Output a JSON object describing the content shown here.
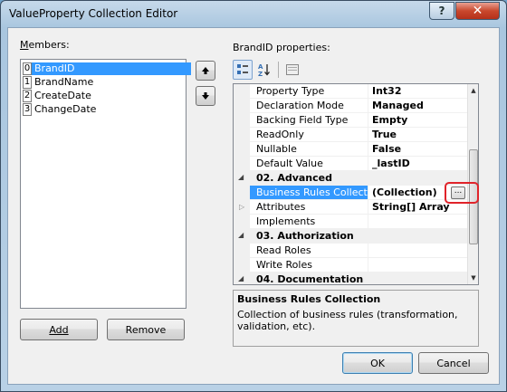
{
  "window": {
    "title": "ValueProperty Collection Editor",
    "help_glyph": "?",
    "close_glyph": "✕"
  },
  "members": {
    "label": "Members:",
    "items": [
      {
        "index": "0",
        "name": "BrandID",
        "selected": true
      },
      {
        "index": "1",
        "name": "BrandName",
        "selected": false
      },
      {
        "index": "2",
        "name": "CreateDate",
        "selected": false
      },
      {
        "index": "3",
        "name": "ChangeDate",
        "selected": false
      }
    ],
    "move_up_icon": "arrow-up",
    "move_down_icon": "arrow-down",
    "add_label": "Add",
    "remove_label": "Remove"
  },
  "properties": {
    "label": "BrandID properties:",
    "toolbar": [
      "categorized-icon",
      "alphabetical-icon",
      "property-pages-icon"
    ],
    "rows": [
      {
        "kind": "prop",
        "name": "Property Type",
        "value": "Int32"
      },
      {
        "kind": "prop",
        "name": "Declaration Mode",
        "value": "Managed"
      },
      {
        "kind": "prop",
        "name": "Backing Field Type",
        "value": "Empty"
      },
      {
        "kind": "prop",
        "name": "ReadOnly",
        "value": "True"
      },
      {
        "kind": "prop",
        "name": "Nullable",
        "value": "False"
      },
      {
        "kind": "prop",
        "name": "Default Value",
        "value": "_lastID"
      },
      {
        "kind": "category",
        "name": "02. Advanced"
      },
      {
        "kind": "prop",
        "name": "Business Rules Collection",
        "value": "(Collection)",
        "selected": true
      },
      {
        "kind": "prop",
        "name": "Attributes",
        "value": "String[] Array",
        "expandable": true
      },
      {
        "kind": "prop",
        "name": "Implements",
        "value": ""
      },
      {
        "kind": "category",
        "name": "03. Authorization"
      },
      {
        "kind": "prop",
        "name": "Read Roles",
        "value": ""
      },
      {
        "kind": "prop",
        "name": "Write Roles",
        "value": ""
      },
      {
        "kind": "category",
        "name": "04. Documentation"
      }
    ],
    "ellipsis_label": "...",
    "description": {
      "title": "Business Rules Collection",
      "text": "Collection of business rules (transformation, validation, etc)."
    }
  },
  "footer": {
    "ok_label": "OK",
    "cancel_label": "Cancel"
  }
}
